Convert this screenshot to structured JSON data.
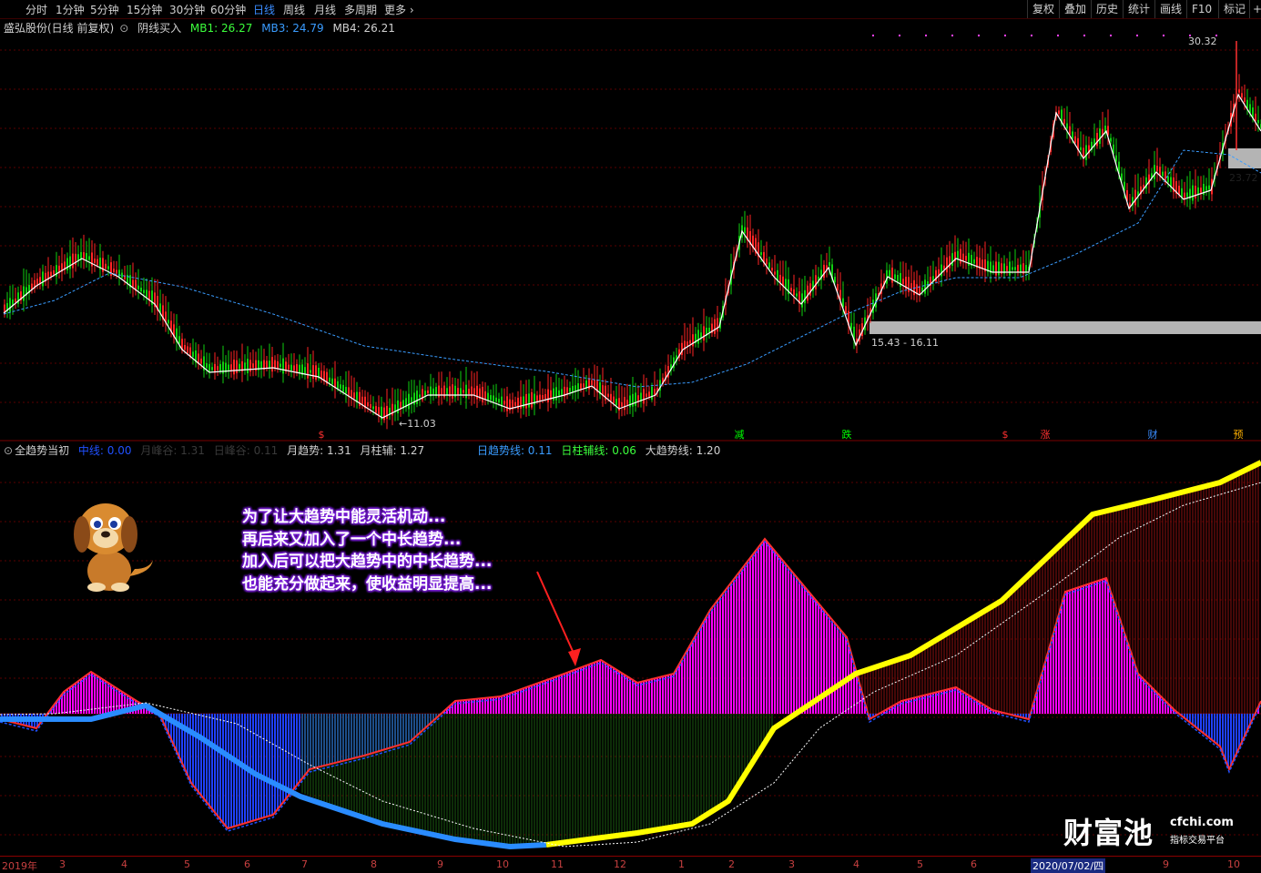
{
  "toolbar": {
    "periods": [
      "分时",
      "1分钟",
      "5分钟",
      "15分钟",
      "30分钟",
      "60分钟",
      "日线",
      "周线",
      "月线",
      "多周期",
      "更多"
    ],
    "active_period": "日线",
    "right_buttons": [
      "复权",
      "叠加",
      "历史",
      "统计",
      "画线",
      "F10",
      "标记"
    ]
  },
  "main_panel": {
    "stock_label": "盛弘股份(日线 前复权)",
    "indicator_name": "阴线买入",
    "mb1_label": "MB1: 26.27",
    "mb3_label": "MB3: 24.79",
    "mb4_label": "MB4: 26.21",
    "high_price": "30.32",
    "right_price": "23.72",
    "low_price": "←11.03",
    "zone_label": "15.43 - 16.11",
    "signals": [
      {
        "text": "$",
        "color": "#ff3030"
      },
      {
        "text": "减",
        "color": "#00ff00"
      },
      {
        "text": "跌",
        "color": "#00ff00"
      },
      {
        "text": "$",
        "color": "#ff3030"
      },
      {
        "text": "涨",
        "color": "#ff3030"
      },
      {
        "text": "财",
        "color": "#3a8cff"
      },
      {
        "text": "预",
        "color": "#ffb000"
      }
    ]
  },
  "indicator_panel": {
    "name": "全趋势当初",
    "zx_label": "中线: 0.00",
    "yfg_label": "月峰谷: 1.31",
    "rfg_label": "日峰谷: 0.11",
    "yqs_label": "月趋势: 1.31",
    "yzf_label": "月柱辅: 1.27",
    "rqsx_label": "日趋势线: 0.11",
    "rzfx_label": "日柱辅线: 0.06",
    "dqsx_label": "大趋势线: 1.20"
  },
  "annotation": [
    "为了让大趋势中能灵活机动...",
    "再后来又加入了一个中长趋势...",
    "加入后可以把大趋势中的中长趋势...",
    "也能充分做起来，使收益明显提高..."
  ],
  "date_axis": [
    "2019年",
    "3",
    "4",
    "5",
    "6",
    "7",
    "8",
    "9",
    "10",
    "11",
    "12",
    "1",
    "2",
    "3",
    "4",
    "5",
    "6",
    "2020/07/02/四",
    "9",
    "10"
  ],
  "logo": {
    "brand": "财富池",
    "url": "cfchi.com",
    "tagline": "指标交易平台"
  },
  "colors": {
    "bg": "#000000",
    "up": "#ff2020",
    "down": "#00d000",
    "magenta": "#ff00ff",
    "blue": "#2040ff",
    "yellow": "#ffff00",
    "darkred": "#8b1010",
    "green_hist": "#1a5a10",
    "accent": "#3a8cff"
  }
}
